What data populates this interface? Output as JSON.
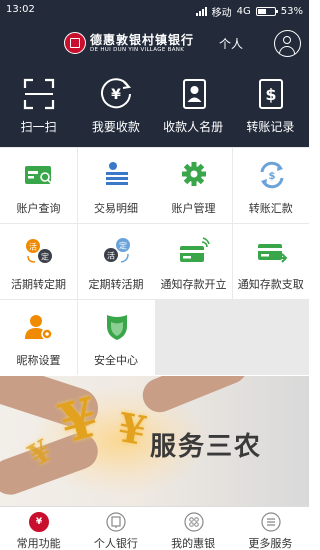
{
  "status_bar": {
    "time": "13:02",
    "carrier": "移动",
    "network": "4G",
    "battery_percent_label": "53%",
    "battery_level": 0.53
  },
  "header": {
    "bank_name_cn": "德惠敦银村镇银行",
    "bank_name_en": "DE HUI DUN YIN VILLAGE BANK",
    "personal_label": "个人"
  },
  "quick_actions": [
    {
      "label": "扫一扫",
      "icon": "scan-icon"
    },
    {
      "label": "我要收款",
      "icon": "receive-money-icon"
    },
    {
      "label": "收款人名册",
      "icon": "payee-book-icon"
    },
    {
      "label": "转账记录",
      "icon": "transfer-record-icon"
    }
  ],
  "grid_items": [
    {
      "label": "账户查询",
      "icon": "account-query-icon"
    },
    {
      "label": "交易明细",
      "icon": "transaction-detail-icon"
    },
    {
      "label": "账户管理",
      "icon": "account-manage-gear-icon"
    },
    {
      "label": "转账汇款",
      "icon": "transfer-remit-icon"
    },
    {
      "label": "活期转定期",
      "icon": "current-to-fixed-icon",
      "badges": [
        "活",
        "定"
      ]
    },
    {
      "label": "定期转活期",
      "icon": "fixed-to-current-icon",
      "badges": [
        "活",
        "定"
      ]
    },
    {
      "label": "通知存款开立",
      "icon": "notice-deposit-open-icon"
    },
    {
      "label": "通知存款支取",
      "icon": "notice-deposit-withdraw-icon"
    },
    {
      "label": "昵称设置",
      "icon": "nickname-setting-icon"
    },
    {
      "label": "安全中心",
      "icon": "security-shield-icon"
    }
  ],
  "banner": {
    "slogan": "服务三农",
    "yen_symbol": "¥"
  },
  "tabs": [
    {
      "label": "常用功能",
      "icon": "common-functions-icon",
      "active": true,
      "glyph": "¥"
    },
    {
      "label": "个人银行",
      "icon": "personal-bank-icon",
      "active": false
    },
    {
      "label": "我的惠银",
      "icon": "my-huiyin-icon",
      "active": false
    },
    {
      "label": "更多服务",
      "icon": "more-services-icon",
      "active": false
    }
  ],
  "colors": {
    "header_bg": "#232b3a",
    "accent_red": "#c8102e",
    "green": "#3aa64a",
    "blue": "#3b78c8",
    "orange": "#f08a00"
  }
}
